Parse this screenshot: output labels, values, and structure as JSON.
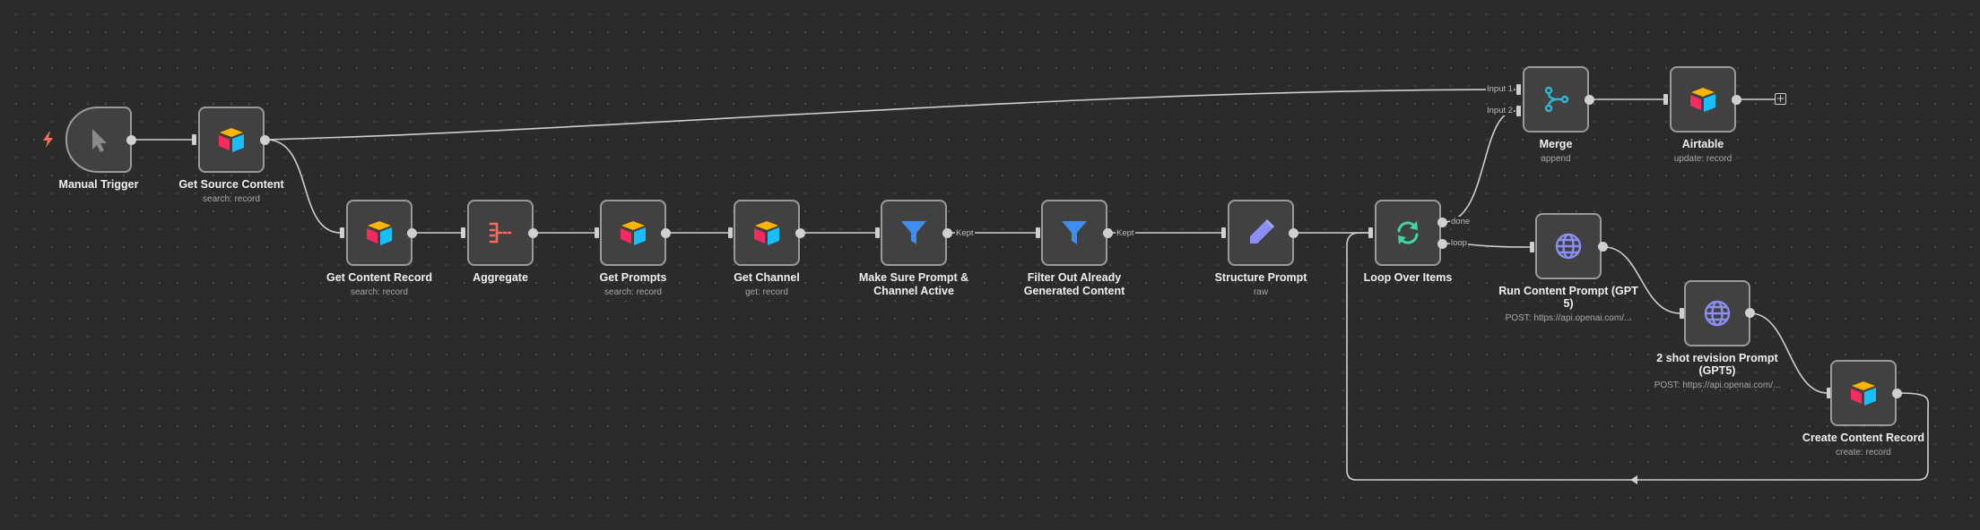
{
  "nodes": {
    "manual_trigger": {
      "title": "Manual Trigger",
      "subtitle": ""
    },
    "get_source_content": {
      "title": "Get Source Content",
      "subtitle": "search: record"
    },
    "get_content_record": {
      "title": "Get Content Record",
      "subtitle": "search: record"
    },
    "aggregate": {
      "title": "Aggregate",
      "subtitle": ""
    },
    "get_prompts": {
      "title": "Get Prompts",
      "subtitle": "search: record"
    },
    "get_channel": {
      "title": "Get Channel",
      "subtitle": "get: record"
    },
    "make_sure_prompt": {
      "title_line1": "Make Sure Prompt &",
      "title_line2": "Channel Active",
      "subtitle": ""
    },
    "filter_out": {
      "title_line1": "Filter Out Already",
      "title_line2": "Generated Content",
      "subtitle": ""
    },
    "structure_prompt": {
      "title": "Structure Prompt",
      "subtitle": "raw"
    },
    "loop_over_items": {
      "title": "Loop Over Items",
      "subtitle": ""
    },
    "merge": {
      "title": "Merge",
      "subtitle": "append"
    },
    "airtable": {
      "title": "Airtable",
      "subtitle": "update: record"
    },
    "run_content_prompt": {
      "title_line1": "Run Content Prompt (GPT",
      "title_line2": "5)",
      "subtitle": "POST: https://api.openai.com/..."
    },
    "two_shot_revision": {
      "title_line1": "2 shot revision Prompt",
      "title_line2": "(GPT5)",
      "subtitle": "POST: https://api.openai.com/..."
    },
    "create_content_record": {
      "title": "Create Content Record",
      "subtitle": "create: record"
    }
  },
  "edge_labels": {
    "kept_1": "Kept",
    "kept_2": "Kept",
    "done": "done",
    "loop": "loop",
    "input_1": "Input 1",
    "input_2": "Input 2"
  },
  "icons": {
    "manual_trigger": "cursor-pointer-icon",
    "airtable": "airtable-logo-icon",
    "aggregate": "aggregate-icon",
    "filter": "funnel-icon",
    "structure_prompt": "pencil-icon",
    "loop": "refresh-loop-icon",
    "merge": "merge-branch-icon",
    "http": "globe-icon",
    "trigger_badge": "lightning-bolt-icon",
    "add": "plus-icon"
  },
  "colors": {
    "canvas": "#2b2b2b",
    "node_fill": "#414141",
    "node_border": "#9a9a9a",
    "edge": "#cfcfcf",
    "bolt": "#ff6d5a",
    "funnel": "#3d8ef0",
    "pencil": "#8b8ff5",
    "loop": "#40d6a0",
    "merge": "#31b5d4",
    "globe": "#8b8ff5",
    "aggregate": "#ff6d5a"
  }
}
